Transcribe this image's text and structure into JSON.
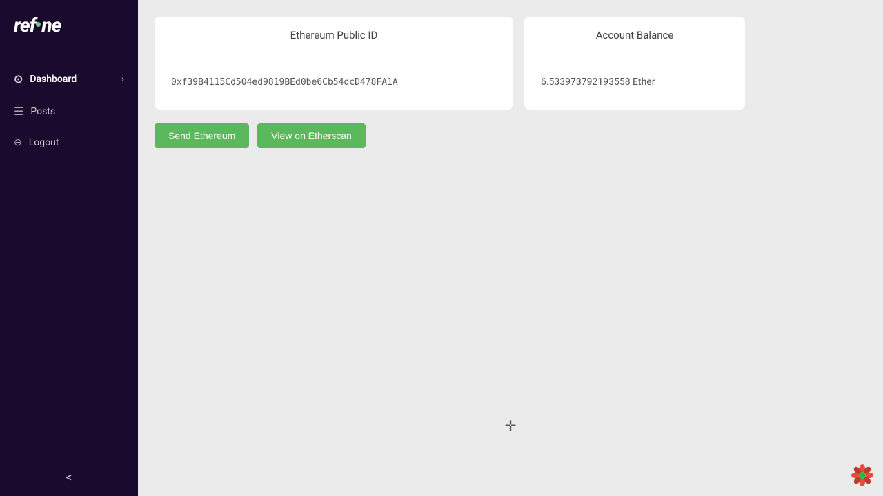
{
  "sidebar": {
    "logo": "refine",
    "nav_items": [
      {
        "id": "dashboard",
        "label": "Dashboard",
        "icon": "⊙",
        "active": true,
        "has_arrow": true
      },
      {
        "id": "posts",
        "label": "Posts",
        "icon": "≡",
        "active": false,
        "has_arrow": false
      },
      {
        "id": "logout",
        "label": "Logout",
        "icon": "↩",
        "active": false,
        "has_arrow": false
      }
    ],
    "collapse_label": "<"
  },
  "main": {
    "ethereum_card": {
      "title": "Ethereum Public ID",
      "address": "0xf39B4115Cd504ed9819BEd0be6Cb54dcD478FA1A"
    },
    "balance_card": {
      "title": "Account Balance",
      "value": "6.533973792193558 Ether"
    },
    "buttons": {
      "send": "Send Ethereum",
      "etherscan": "View on Etherscan"
    }
  }
}
